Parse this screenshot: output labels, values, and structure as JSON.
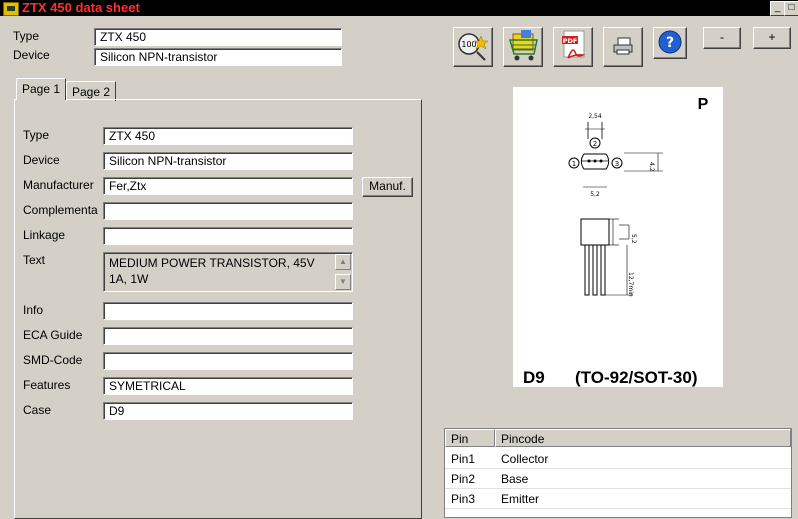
{
  "window": {
    "title": "ZTX 450 data sheet",
    "min_label": "_",
    "max_label": "□"
  },
  "header": {
    "type_label": "Type",
    "type_value": "ZTX 450",
    "device_label": "Device",
    "device_value": "Silicon NPN-transistor"
  },
  "toolbar": {
    "minus_label": "-",
    "plus_label": "+",
    "pdf_label": "PDF",
    "icons": [
      "rating-icon",
      "shopping-cart-icon",
      "pdf-icon",
      "printer-icon",
      "help-icon"
    ]
  },
  "tabs": [
    "Page 1",
    "Page 2"
  ],
  "form": {
    "type_label": "Type",
    "type_value": "ZTX 450",
    "device_label": "Device",
    "device_value": "Silicon NPN-transistor",
    "manufacturer_label": "Manufacturer",
    "manufacturer_value": "Fer,Ztx",
    "manuf_button": "Manuf.",
    "complementary_label": "Complementa",
    "complementary_value": "",
    "linkage_label": "Linkage",
    "linkage_value": "",
    "text_label": "Text",
    "text_value": "MEDIUM POWER TRANSISTOR, 45V 1A, 1W",
    "info_label": "Info",
    "info_value": "",
    "eca_label": "ECA Guide",
    "eca_value": "",
    "smd_label": "SMD-Code",
    "smd_value": "",
    "features_label": "Features",
    "features_value": "SYMETRICAL",
    "case_label": "Case",
    "case_value": "D9"
  },
  "package": {
    "corner": "P",
    "code": "D9",
    "name": "(TO-92/SOT-30)",
    "dim_top": "2,54",
    "dim_width": "5,2",
    "dim_height": "4,2",
    "dim_body": "5,2",
    "dim_lead": "12,7min",
    "pin1": "1",
    "pin2": "2",
    "pin3": "3"
  },
  "pins": {
    "headers": [
      "Pin",
      "Pincode"
    ],
    "rows": [
      [
        "Pin1",
        "Collector"
      ],
      [
        "Pin2",
        "Base"
      ],
      [
        "Pin3",
        "Emitter"
      ]
    ]
  }
}
